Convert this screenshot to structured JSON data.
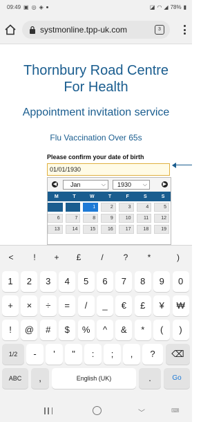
{
  "status_bar": {
    "time": "09:49",
    "battery": "78%"
  },
  "browser": {
    "url": "systmonline.tpp-uk.com",
    "tab_count": "3"
  },
  "page": {
    "title_line1": "Thornbury Road Centre",
    "title_line2": "For Health",
    "service_title": "Appointment invitation service",
    "subtitle": "Flu Vaccination Over 65s",
    "dob_label": "Please confirm your date of birth",
    "dob_value": "01/01/1930"
  },
  "datepicker": {
    "month": "Jan",
    "year": "1930",
    "weekdays": [
      "M",
      "T",
      "W",
      "T",
      "F",
      "S",
      "S"
    ],
    "weeks": [
      [
        "",
        "",
        "1",
        "2",
        "3",
        "4",
        "5"
      ],
      [
        "6",
        "7",
        "8",
        "9",
        "10",
        "11",
        "12"
      ],
      [
        "13",
        "14",
        "15",
        "16",
        "17",
        "18",
        "19"
      ]
    ],
    "selected_day": "1"
  },
  "keyboard": {
    "symbol_row": [
      "<",
      "!",
      "+",
      "£",
      "/",
      "?",
      "*",
      ")"
    ],
    "row1": [
      "1",
      "2",
      "3",
      "4",
      "5",
      "6",
      "7",
      "8",
      "9",
      "0"
    ],
    "row2": [
      "+",
      "×",
      "÷",
      "=",
      "/",
      "_",
      "€",
      "£",
      "¥",
      "₩"
    ],
    "row3": [
      "!",
      "@",
      "#",
      "$",
      "%",
      "^",
      "&",
      "*",
      "(",
      ")"
    ],
    "row4": [
      "1/2",
      "-",
      "'",
      "\"",
      ":",
      ";",
      ",",
      "?",
      "⌫"
    ],
    "row5": {
      "abc": "ABC",
      "comma": ",",
      "space": "English (UK)",
      "period": ".",
      "go": "Go"
    }
  },
  "colors": {
    "brand": "#1a5d8f",
    "selected_day": "#1e7ad6",
    "input_border": "#e0b040"
  }
}
